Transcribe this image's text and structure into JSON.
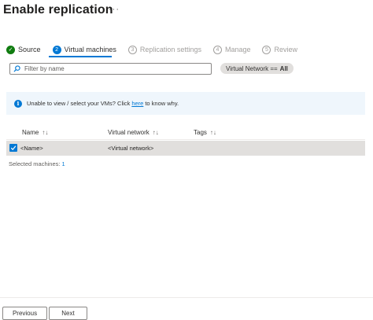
{
  "header": {
    "title": "Enable replication",
    "more_label": "···"
  },
  "steps": [
    {
      "label": "Source",
      "marker": "✓",
      "state": "done"
    },
    {
      "label": "Virtual machines",
      "marker": "2",
      "state": "active"
    },
    {
      "label": "Replication settings",
      "marker": "3",
      "state": "pending"
    },
    {
      "label": "Manage",
      "marker": "4",
      "state": "pending"
    },
    {
      "label": "Review",
      "marker": "5",
      "state": "pending"
    }
  ],
  "filter": {
    "placeholder": "Filter by name",
    "value": ""
  },
  "pill": {
    "key": "Virtual Network ==",
    "value": "All"
  },
  "info": {
    "text_before": "Unable to view / select your VMs? Click ",
    "link_text": "here",
    "text_after": " to know why."
  },
  "table": {
    "columns": [
      {
        "label": "Name",
        "sort_icon": "↑↓"
      },
      {
        "label": "Virtual network",
        "sort_icon": "↑↓"
      },
      {
        "label": "Tags",
        "sort_icon": "↑↓"
      }
    ],
    "rows": [
      {
        "name": "<Name>",
        "virtual_network": "<Virtual network>",
        "tags": "",
        "selected": true
      }
    ]
  },
  "selection": {
    "label": "Selected machines: ",
    "count": "1"
  },
  "footer": {
    "previous_label": "Previous",
    "next_label": "Next"
  },
  "colors": {
    "accent": "#0078d4",
    "success": "#107c10",
    "row_selected_bg": "#e1dfdd",
    "info_bg": "#eff6fc"
  }
}
